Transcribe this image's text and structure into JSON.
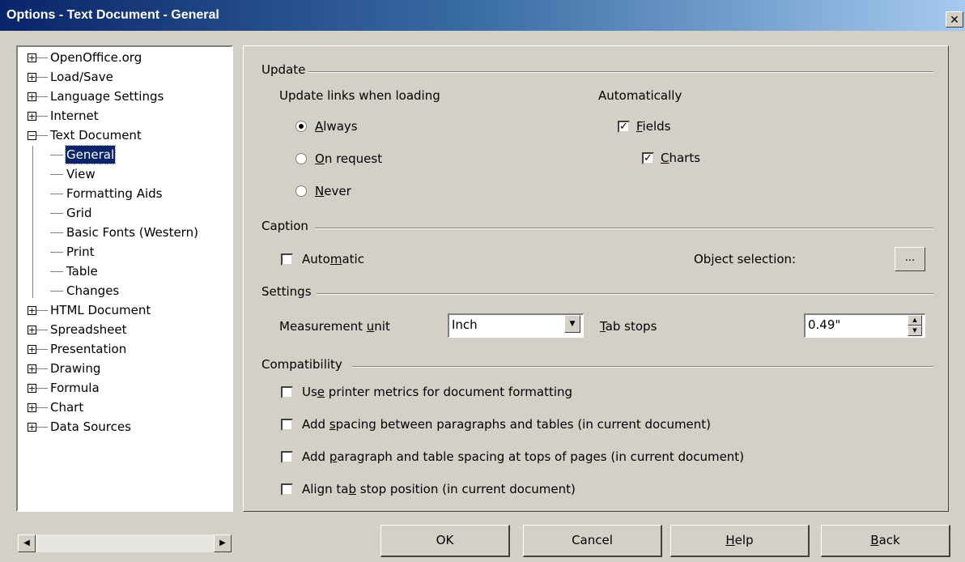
{
  "window": {
    "title": "Options - Text Document - General",
    "close": "✕"
  },
  "tree": {
    "items": [
      {
        "label": "OpenOffice.org",
        "expander": "+"
      },
      {
        "label": "Load/Save",
        "expander": "+"
      },
      {
        "label": "Language Settings",
        "expander": "+"
      },
      {
        "label": "Internet",
        "expander": "+"
      },
      {
        "label": "Text Document",
        "expander": "−"
      },
      {
        "label": "General"
      },
      {
        "label": "View"
      },
      {
        "label": "Formatting Aids"
      },
      {
        "label": "Grid"
      },
      {
        "label": "Basic Fonts (Western)"
      },
      {
        "label": "Print"
      },
      {
        "label": "Table"
      },
      {
        "label": "Changes"
      },
      {
        "label": "HTML Document",
        "expander": "+"
      },
      {
        "label": "Spreadsheet",
        "expander": "+"
      },
      {
        "label": "Presentation",
        "expander": "+"
      },
      {
        "label": "Drawing",
        "expander": "+"
      },
      {
        "label": "Formula",
        "expander": "+"
      },
      {
        "label": "Chart",
        "expander": "+"
      },
      {
        "label": "Data Sources",
        "expander": "+"
      }
    ],
    "selected": "General"
  },
  "update": {
    "heading": "Update",
    "links_label": "Update links when loading",
    "always_pre": "",
    "always_ul": "A",
    "always_post": "lways",
    "onreq_pre": "",
    "onreq_ul": "O",
    "onreq_post": "n request",
    "never_pre": "",
    "never_ul": "N",
    "never_post": "ever",
    "selected": "Always",
    "auto_label": "Automatically",
    "fields_pre": "",
    "fields_ul": "F",
    "fields_post": "ields",
    "charts_pre": "",
    "charts_ul": "C",
    "charts_post": "harts",
    "fields_checked": true,
    "charts_checked": true
  },
  "caption": {
    "heading": "Caption",
    "auto_pre": "Auto",
    "auto_ul": "m",
    "auto_post": "atic",
    "auto_checked": false,
    "objsel_label": "Object selection:",
    "objsel_button": "..."
  },
  "settings": {
    "heading": "Settings",
    "unit_pre": "Measurement ",
    "unit_ul": "u",
    "unit_post": "nit",
    "unit_value": "Inch",
    "tab_pre": "",
    "tab_ul": "T",
    "tab_post": "ab stops",
    "tab_value": "0.49\""
  },
  "compat": {
    "heading": "Compatibility",
    "opt1_pre": "Us",
    "opt1_ul": "e",
    "opt1_post": " printer metrics for document formatting",
    "opt2_pre": "Add ",
    "opt2_ul": "s",
    "opt2_post": "pacing between paragraphs and tables (in current document)",
    "opt3_pre": "Add ",
    "opt3_ul": "p",
    "opt3_post": "aragraph and table spacing at tops of pages (in current document)",
    "opt4_pre": "Align ta",
    "opt4_ul": "b",
    "opt4_post": " stop position (in current document)"
  },
  "buttons": {
    "ok": "OK",
    "cancel": "Cancel",
    "help_pre": "",
    "help_ul": "H",
    "help_post": "elp",
    "back_pre": "",
    "back_ul": "B",
    "back_post": "ack"
  }
}
